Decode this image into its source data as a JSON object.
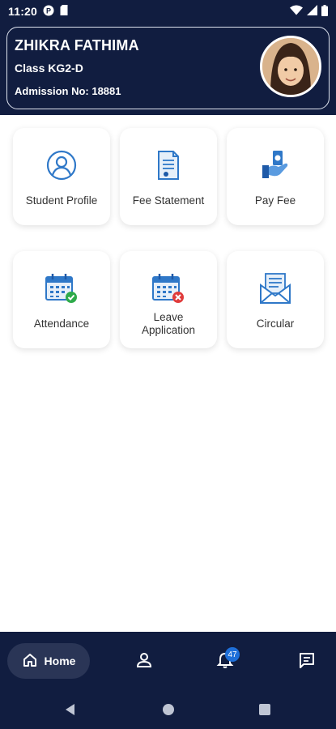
{
  "status_bar": {
    "time": "11:20"
  },
  "student": {
    "name": "ZHIKRA FATHIMA",
    "class": "Class KG2-D",
    "admission": "Admission No: 18881"
  },
  "tiles": [
    {
      "label": "Student Profile",
      "icon": "user-circle-icon"
    },
    {
      "label": "Fee Statement",
      "icon": "document-icon"
    },
    {
      "label": "Pay Fee",
      "icon": "hand-money-icon"
    },
    {
      "label": "Attendance",
      "icon": "calendar-check-icon"
    },
    {
      "label": "Leave",
      "label2": "Application",
      "icon": "calendar-cross-icon"
    },
    {
      "label": "Circular",
      "icon": "envelope-icon"
    }
  ],
  "bottom_nav": {
    "home_label": "Home",
    "notification_count": "47"
  },
  "colors": {
    "primary": "#111d40",
    "accent": "#1e6fd9",
    "icon_blue": "#2f78c8"
  }
}
